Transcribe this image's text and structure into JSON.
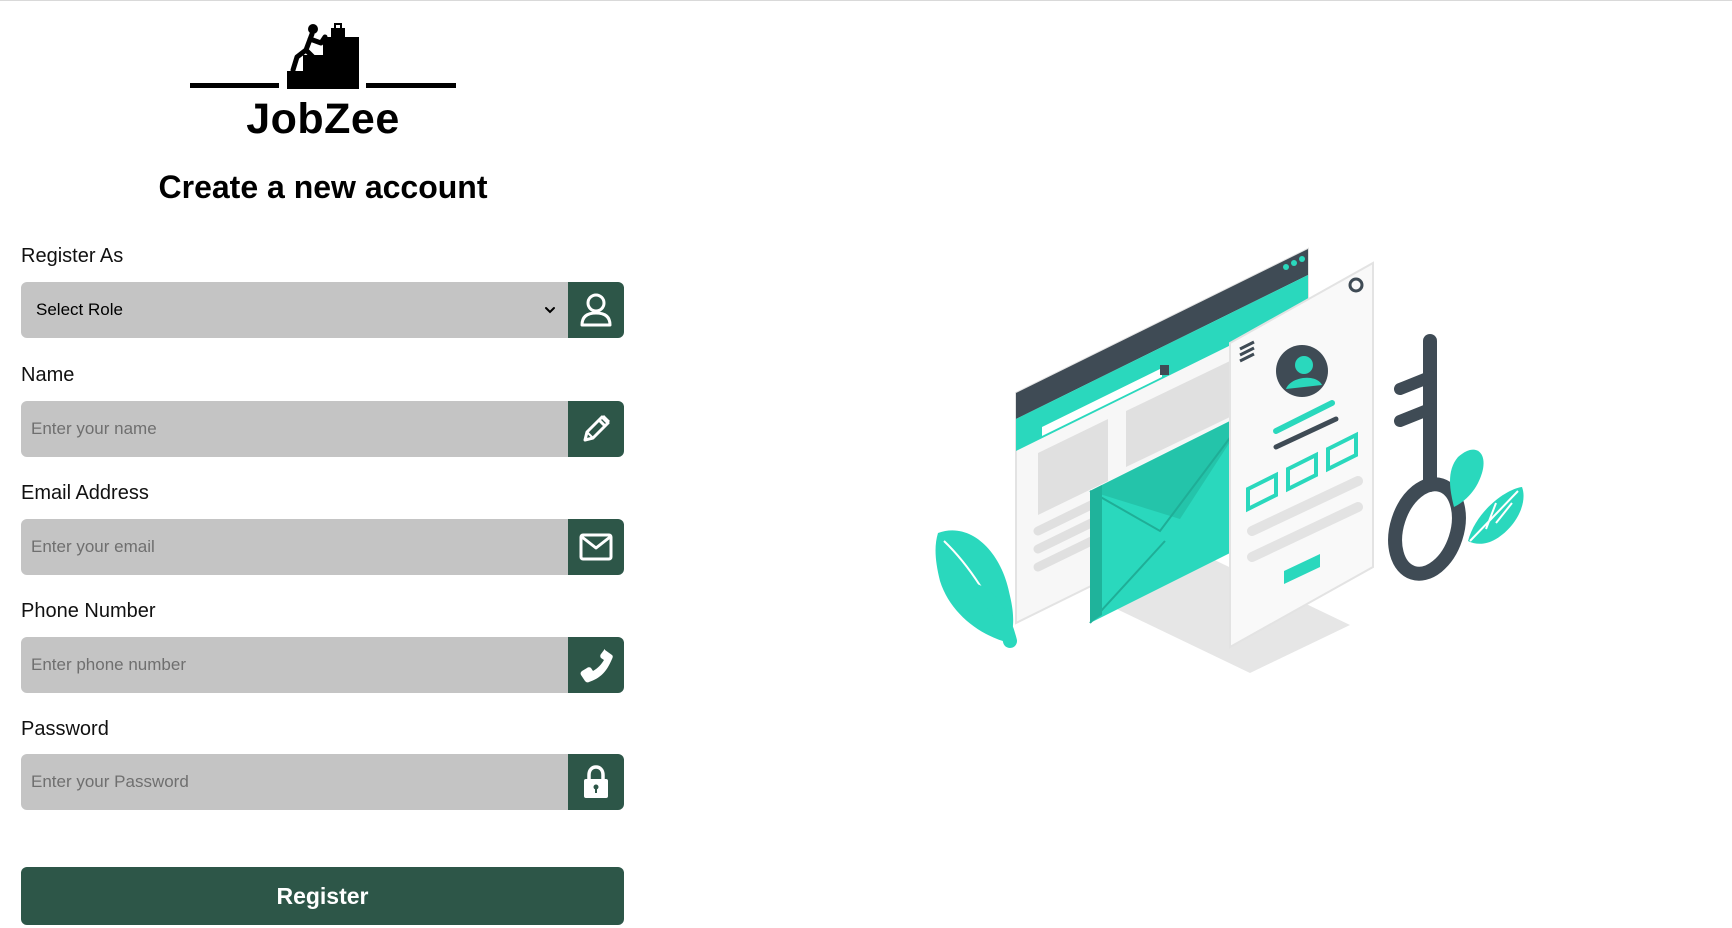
{
  "brand": {
    "name": "JobZee",
    "logo_icon": "climber-stairs-icon"
  },
  "form": {
    "title": "Create a new account",
    "role": {
      "label": "Register As",
      "value": "Select Role",
      "icon": "user-icon"
    },
    "name": {
      "label": "Name",
      "placeholder": "Enter your name",
      "icon": "pencil-icon"
    },
    "email": {
      "label": "Email Address",
      "placeholder": "Enter your email",
      "icon": "envelope-icon"
    },
    "phone": {
      "label": "Phone Number",
      "placeholder": "Enter phone number",
      "icon": "phone-icon"
    },
    "password": {
      "label": "Password",
      "placeholder": "Enter your Password",
      "icon": "lock-icon"
    },
    "submit_label": "Register"
  },
  "colors": {
    "accent": "#2d5648",
    "field_bg": "#c4c4c4",
    "illustration_teal": "#2ad8bd",
    "illustration_dark": "#3f4b55"
  }
}
